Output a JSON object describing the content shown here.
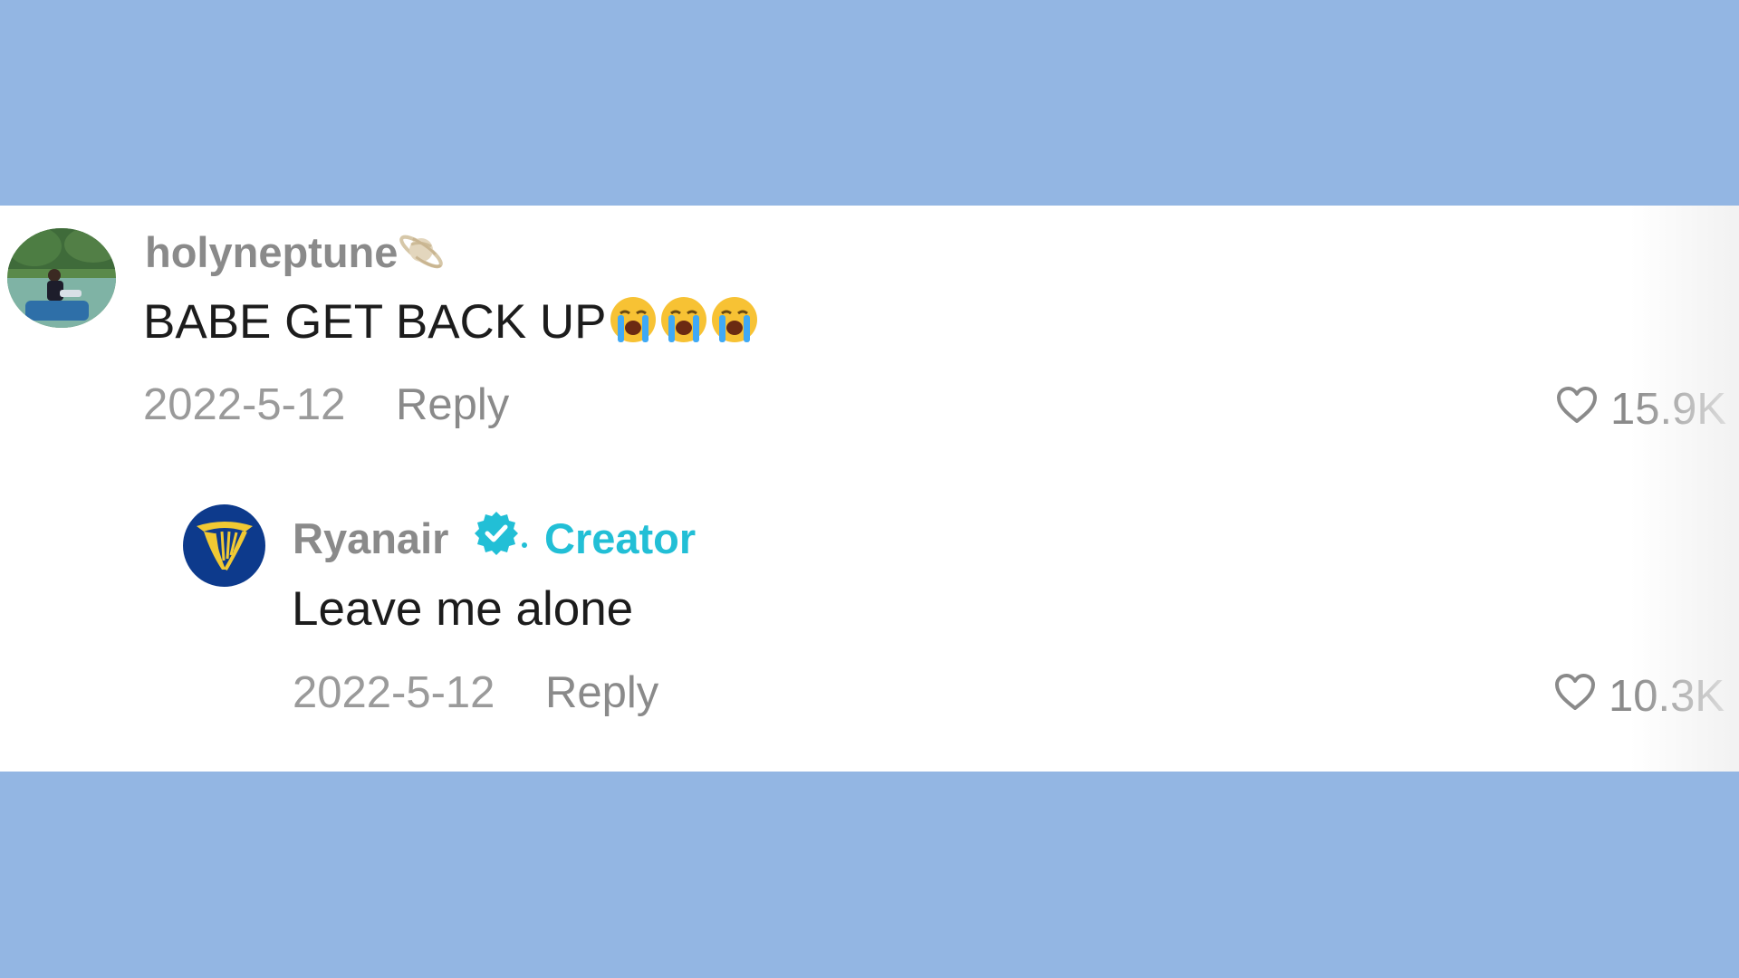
{
  "comments": [
    {
      "username": "holyneptune",
      "username_emoji": "saturn-planet-icon",
      "text": "BABE GET BACK UP",
      "text_emojis": [
        "loudly-crying-face-icon",
        "loudly-crying-face-icon",
        "loudly-crying-face-icon"
      ],
      "date": "2022-5-12",
      "reply_label": "Reply",
      "likes": "15.9K"
    }
  ],
  "reply": {
    "username": "Ryanair",
    "badge": "Creator",
    "text": "Leave me alone",
    "date": "2022-5-12",
    "reply_label": "Reply",
    "likes": "10.3K"
  },
  "colors": {
    "background": "#93b6e3",
    "card": "#ffffff",
    "creator_accent": "#22bfd6",
    "brand_blue": "#0d3a8c",
    "brand_yellow": "#f1c933"
  }
}
